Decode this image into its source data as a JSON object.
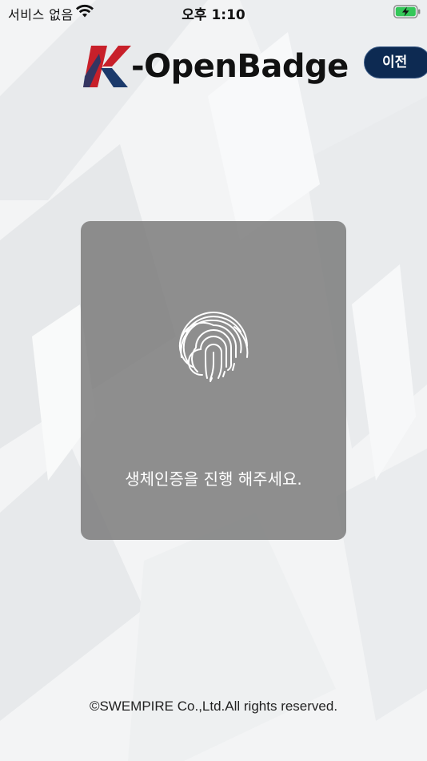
{
  "status_bar": {
    "carrier": "서비스 없음",
    "time": "오후 1:10",
    "wifi_icon": "wifi-icon",
    "battery_icon": "battery-charging-icon"
  },
  "header": {
    "logo_letter": "K",
    "logo_text": "-OpenBadge",
    "back_label": "이전"
  },
  "auth": {
    "icon": "fingerprint-icon",
    "message": "생체인증을 진행 해주세요."
  },
  "footer": {
    "copyright": "©SWEMPIRE Co.,Ltd.All rights reserved."
  },
  "colors": {
    "back_button": "#0d2a52",
    "logo_red": "#c8202a",
    "logo_navy": "#1b3a6b",
    "panel": "#7a7a7a",
    "battery_green": "#34c759"
  }
}
